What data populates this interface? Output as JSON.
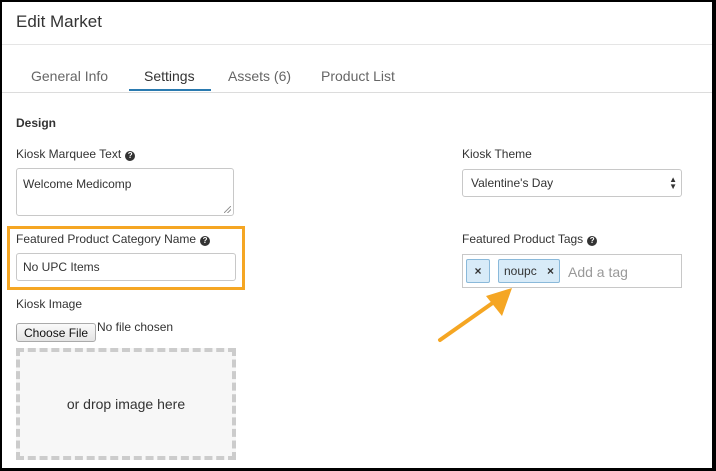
{
  "header": {
    "title": "Edit Market"
  },
  "tabs": [
    {
      "label": "General Info"
    },
    {
      "label": "Settings"
    },
    {
      "label": "Assets (6)"
    },
    {
      "label": "Product List"
    }
  ],
  "design": {
    "section_title": "Design",
    "marquee": {
      "label": "Kiosk Marquee Text",
      "value": "Welcome Medicomp"
    },
    "featured_category": {
      "label": "Featured Product Category Name",
      "value": "No UPC Items"
    },
    "kiosk_image": {
      "label": "Kiosk Image",
      "choose_label": "Choose File",
      "no_file_text": "No file chosen",
      "drop_text": "or drop image here"
    },
    "theme": {
      "label": "Kiosk Theme",
      "value": "Valentine's Day"
    },
    "tags": {
      "label": "Featured Product Tags",
      "items": [
        {
          "text": "noupc"
        }
      ],
      "remove_glyph": "×",
      "placeholder": "Add a tag"
    }
  },
  "icons": {
    "help": "question-circle-icon",
    "caret": "select-caret-icon"
  },
  "colors": {
    "accent": "#2a7ab0",
    "highlight": "#f5a623",
    "tag_bg": "#d8ebf8"
  }
}
